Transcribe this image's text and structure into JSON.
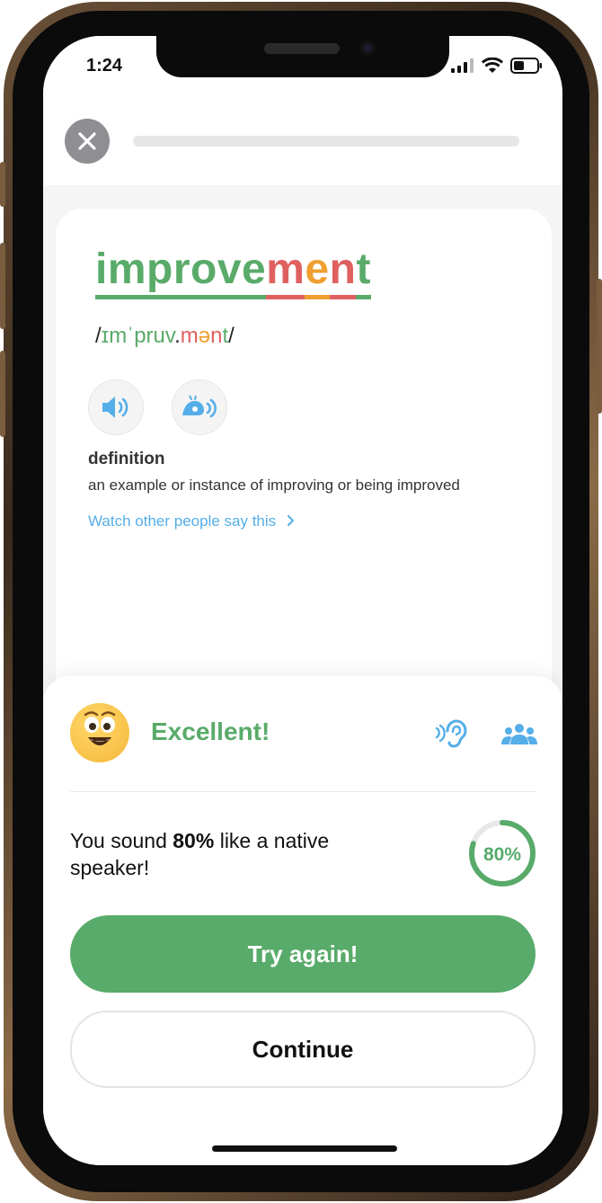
{
  "status_bar": {
    "time": "1:24"
  },
  "lesson": {
    "word_segments": [
      {
        "text": "impro",
        "color": "#5aab6a"
      },
      {
        "text": "ve",
        "color": "#5aab6a"
      },
      {
        "text": "m",
        "color": "#e06060"
      },
      {
        "text": "e",
        "color": "#f0a030"
      },
      {
        "text": "n",
        "color": "#e06060"
      },
      {
        "text": "t",
        "color": "#5aab6a"
      }
    ],
    "ipa_segments": [
      {
        "text": "/",
        "color": "#222222"
      },
      {
        "text": "ɪmˈpruv",
        "color": "#5aab6a"
      },
      {
        "text": ".",
        "color": "#222222"
      },
      {
        "text": "m",
        "color": "#e06060"
      },
      {
        "text": "ə",
        "color": "#f0a030"
      },
      {
        "text": "n",
        "color": "#e06060"
      },
      {
        "text": "t",
        "color": "#5aab6a"
      },
      {
        "text": "/",
        "color": "#222222"
      }
    ],
    "definition_title": "definition",
    "definition_text": "an example or instance of improving or being improved",
    "watch_link": "Watch other people say this"
  },
  "result": {
    "title": "Excellent!",
    "score_prefix": "You sound ",
    "score_value": "80%",
    "score_suffix": " like a native speaker!",
    "ring_label": "80%",
    "ring_fraction": 0.8
  },
  "buttons": {
    "try_again": "Try again!",
    "continue": "Continue"
  },
  "colors": {
    "green": "#58ab6a",
    "blue": "#55aee8",
    "red": "#e06060",
    "orange": "#f0a030"
  },
  "icons": {
    "close": "close-icon",
    "play": "speaker-icon",
    "slow_play": "snail-speaker-icon",
    "listen": "ear-icon",
    "community": "people-icon"
  }
}
